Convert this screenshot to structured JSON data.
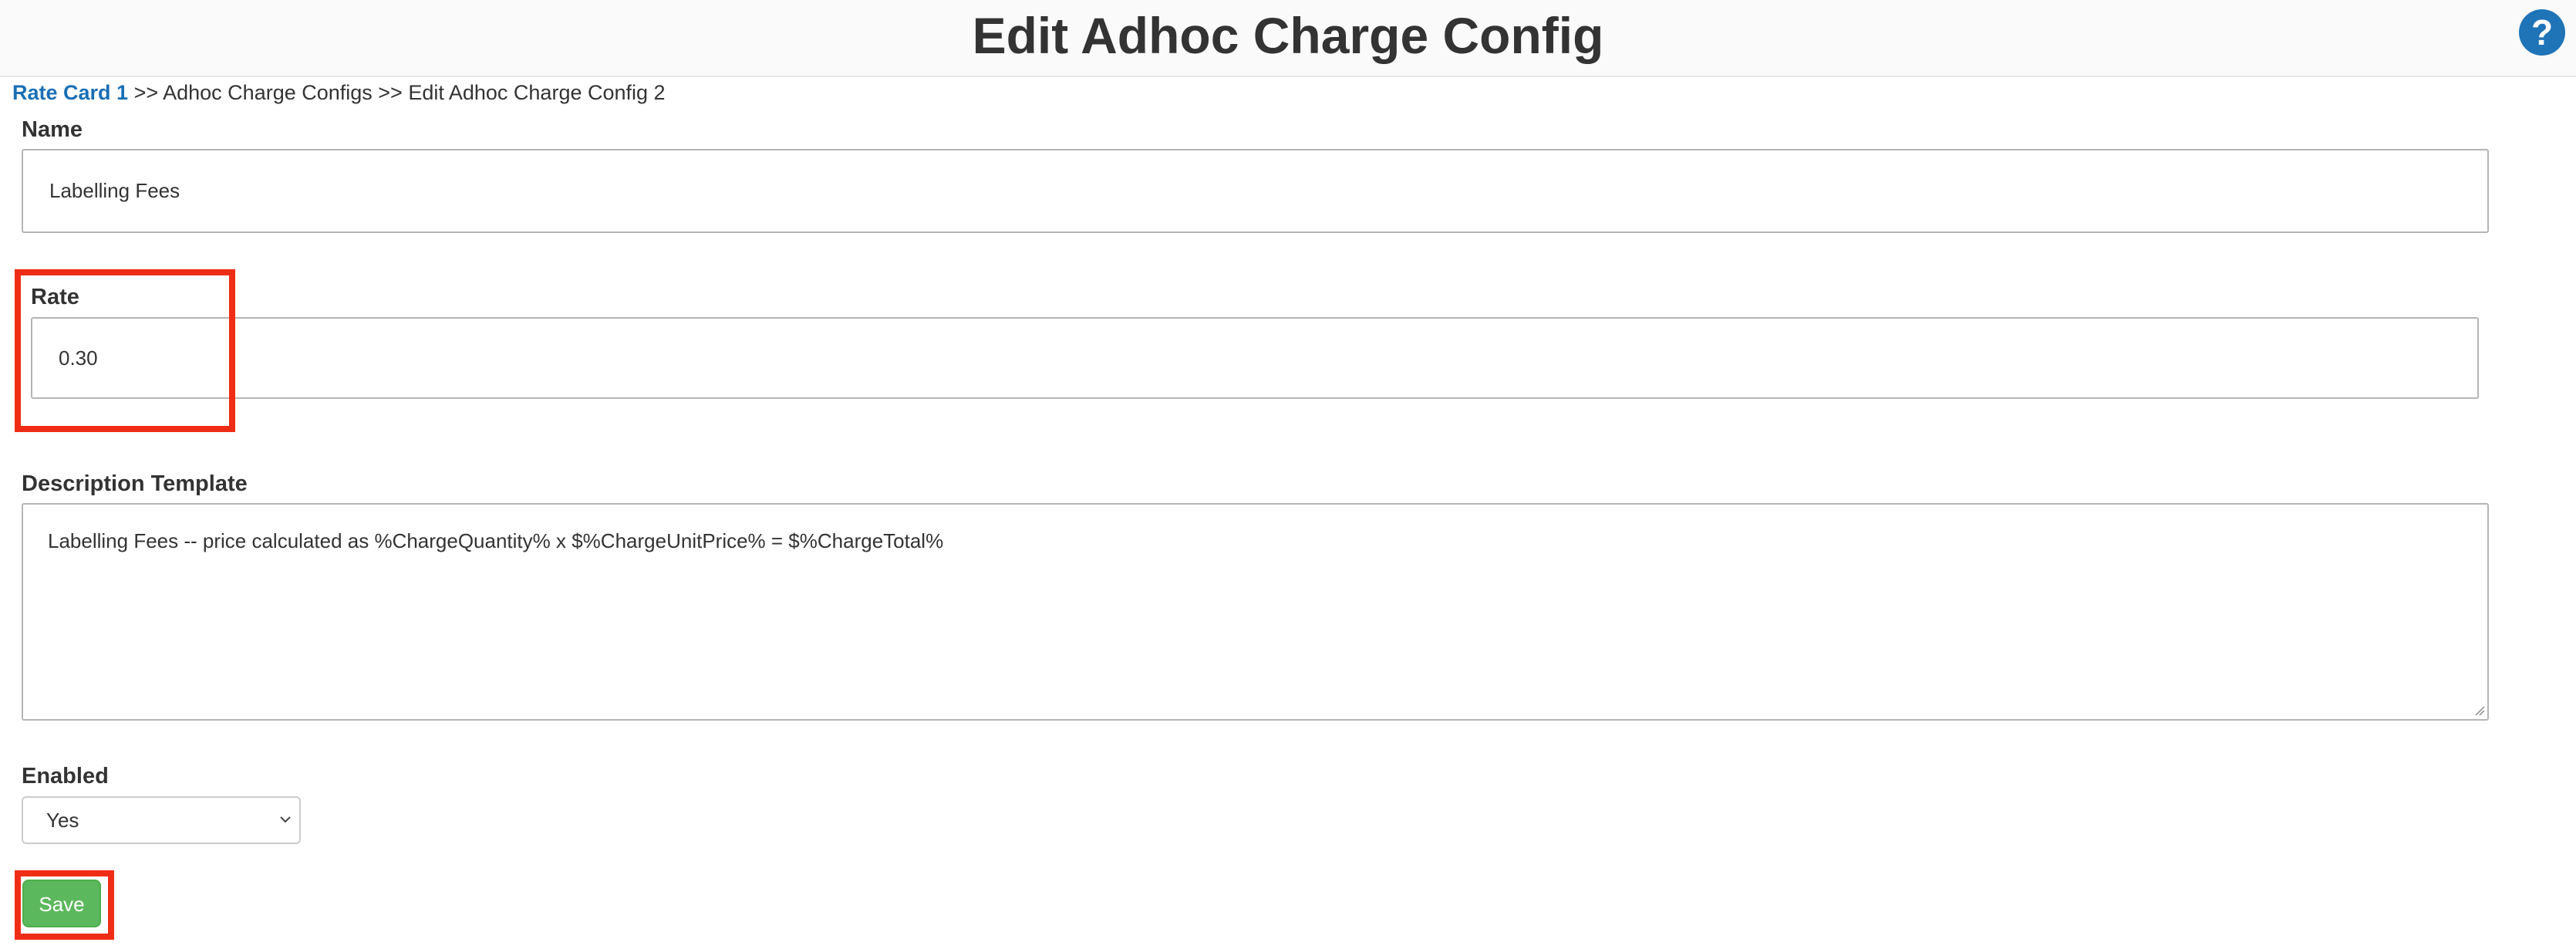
{
  "header": {
    "title": "Edit Adhoc Charge Config",
    "help_icon": "question-circle-icon",
    "help_glyph": "?"
  },
  "breadcrumb": {
    "link_label": "Rate Card 1",
    "rest": ">> Adhoc Charge Configs >> Edit Adhoc Charge Config 2"
  },
  "form": {
    "name": {
      "label": "Name",
      "value": "Labelling Fees"
    },
    "rate": {
      "label": "Rate",
      "value": "0.30"
    },
    "description": {
      "label": "Description Template",
      "value": "Labelling Fees -- price calculated as %ChargeQuantity% x $%ChargeUnitPrice% = $%ChargeTotal%"
    },
    "enabled": {
      "label": "Enabled",
      "selected": "Yes"
    },
    "save_label": "Save"
  },
  "colors": {
    "link": "#1a6fb5",
    "help": "#1f73b7",
    "save": "#5cb85c",
    "highlight": "#ef2d16"
  }
}
